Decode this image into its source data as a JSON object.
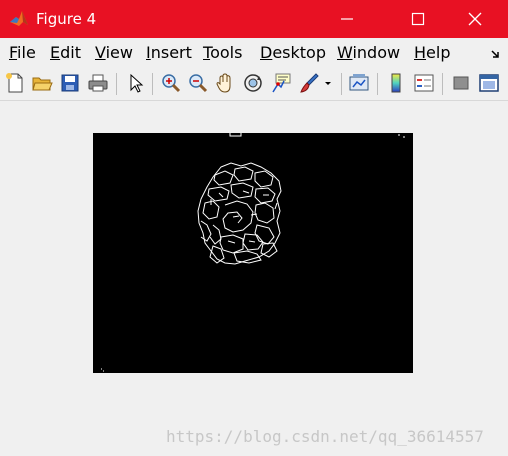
{
  "window": {
    "title": "Figure 4",
    "controls": [
      "minimize",
      "maximize",
      "close"
    ]
  },
  "menu": {
    "items": [
      {
        "accel": "F",
        "rest": "ile"
      },
      {
        "accel": "E",
        "rest": "dit"
      },
      {
        "accel": "V",
        "rest": "iew"
      },
      {
        "accel": "I",
        "rest": "nsert"
      },
      {
        "accel": "T",
        "rest": "ools"
      },
      {
        "accel": "D",
        "rest": "esktop"
      },
      {
        "accel": "W",
        "rest": "indow"
      },
      {
        "accel": "H",
        "rest": "elp"
      }
    ]
  },
  "toolbar": {
    "icons": [
      "new-figure-icon",
      "open-file-icon",
      "save-icon",
      "print-icon",
      "select-arrow-icon",
      "zoom-in-icon",
      "zoom-out-icon",
      "pan-hand-icon",
      "rotate-3d-icon",
      "data-cursor-icon",
      "brush-icon",
      "brush-dropdown-icon",
      "link-plot-icon",
      "colorbar-icon",
      "legend-icon",
      "hide-plot-tools-icon",
      "show-plot-tools-icon"
    ]
  },
  "figure": {
    "content": "binary edge-detection image (white edges on black)"
  },
  "watermark": "https://blog.csdn.net/qq_36614557",
  "colors": {
    "titlebar": "#e81123",
    "figure_bg": "#f0f0f0",
    "axes_bg": "#000000",
    "edge": "#ffffff"
  }
}
